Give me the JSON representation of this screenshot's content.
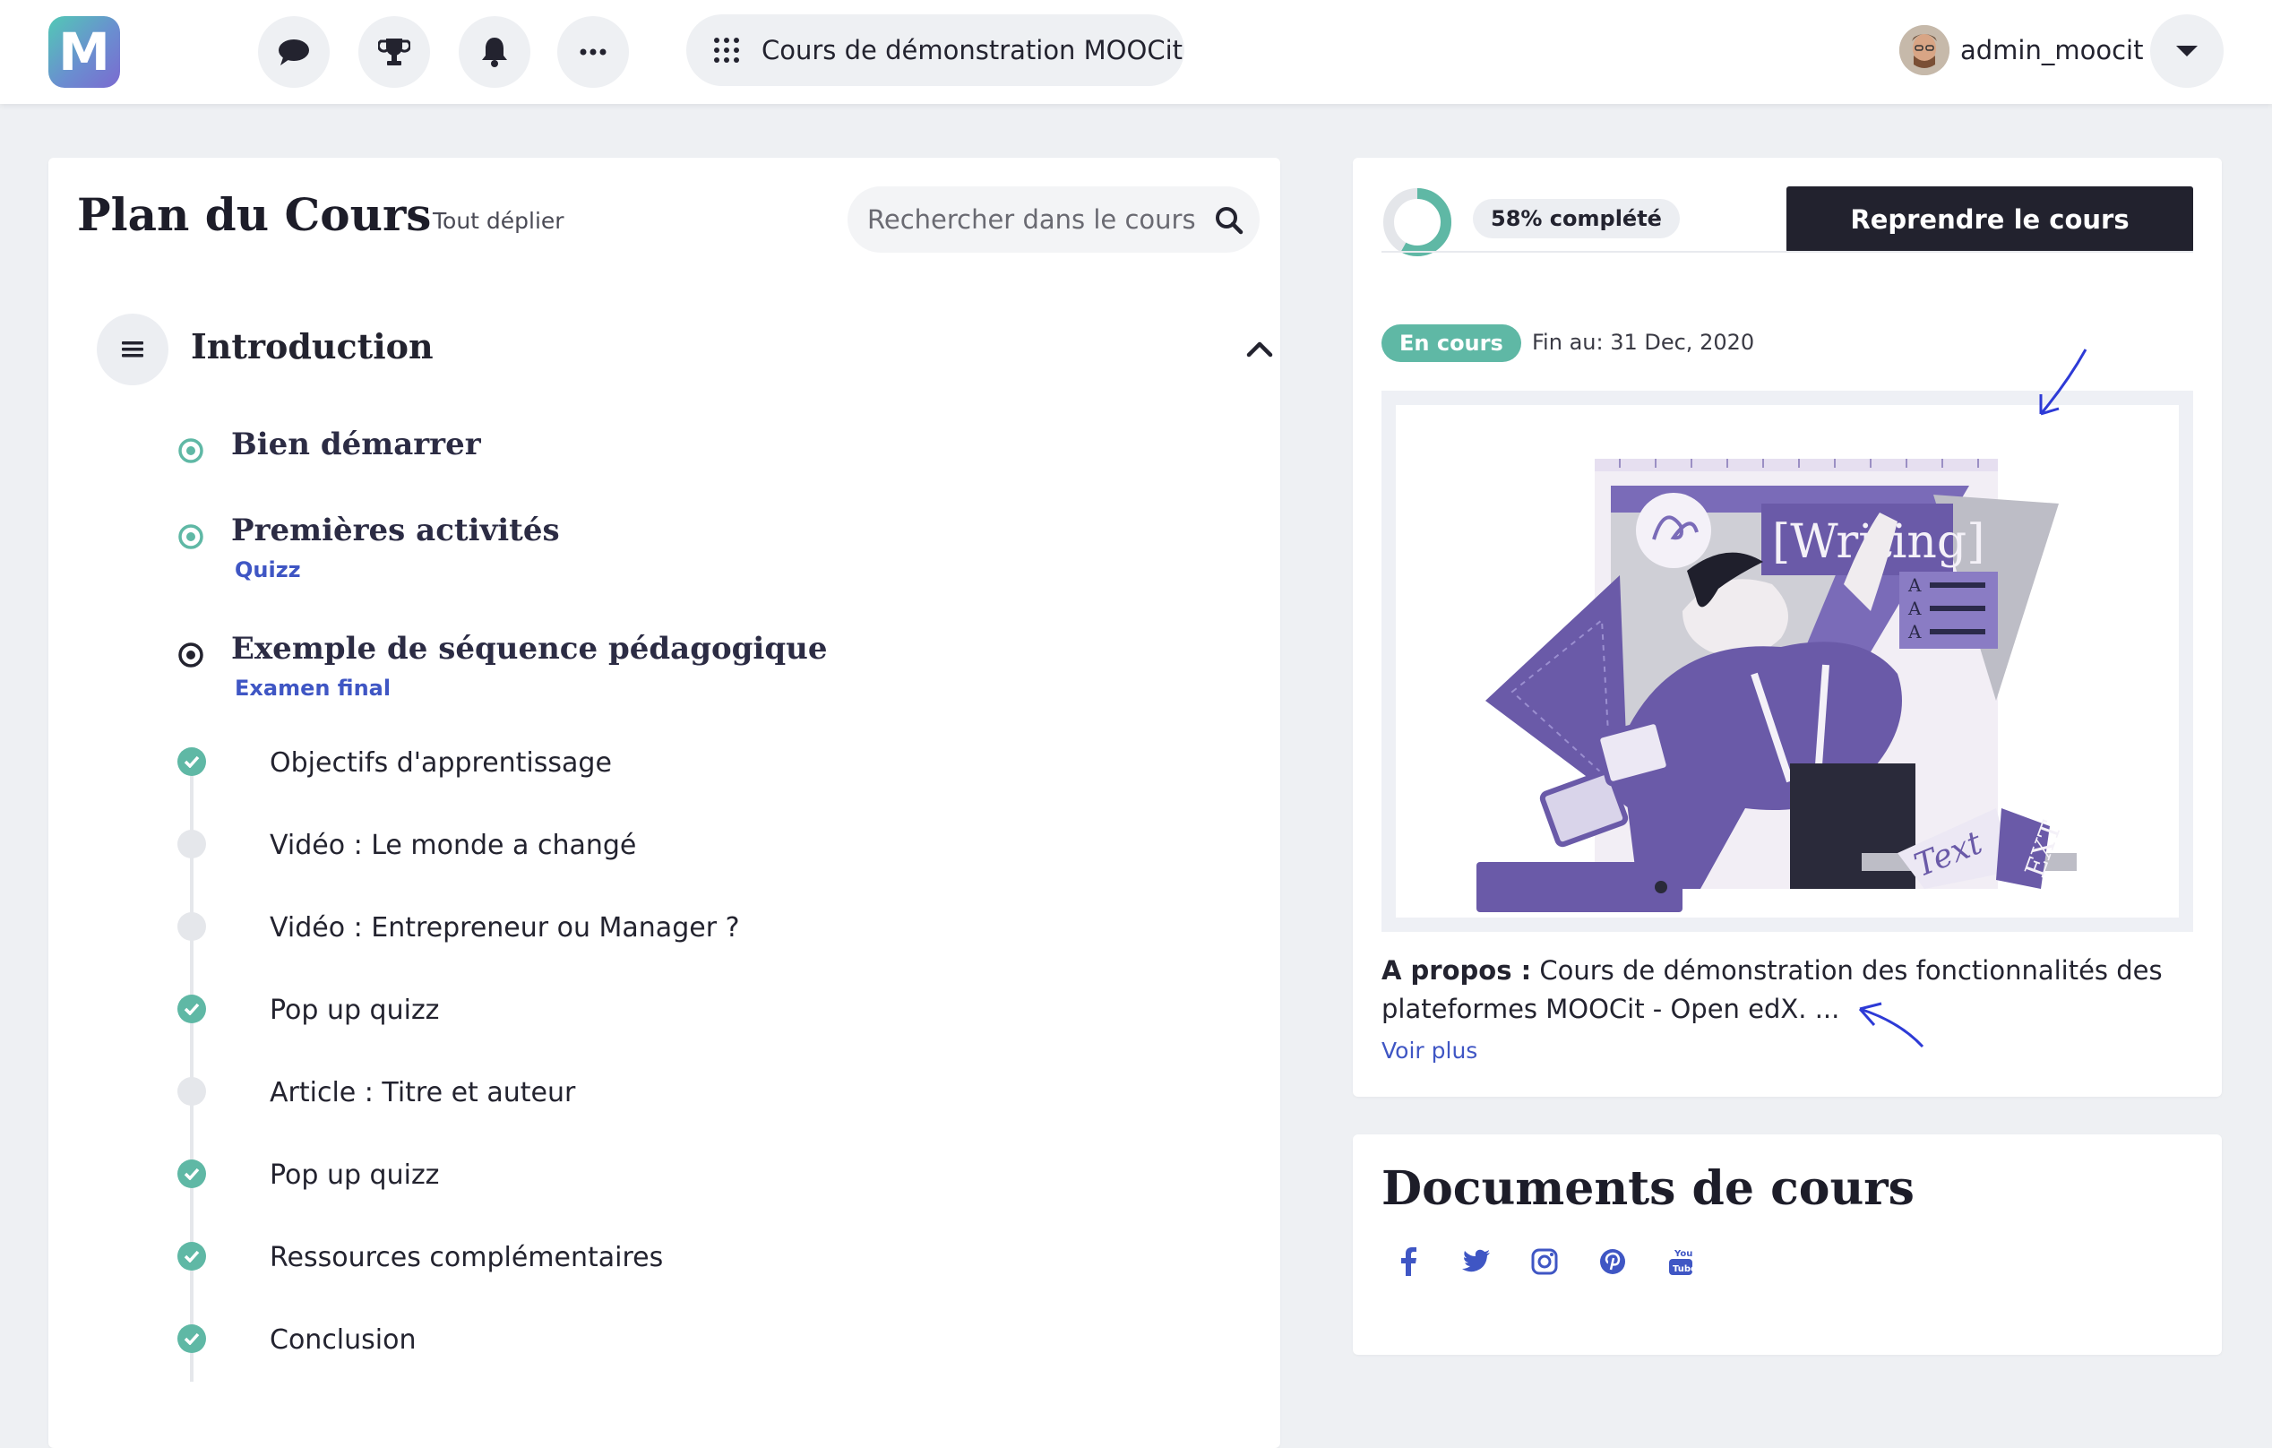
{
  "header": {
    "logo_letter": "M",
    "course_name": "Cours de démonstration MOOCit",
    "username": "admin_moocit",
    "icons": [
      "chat-icon",
      "trophy-icon",
      "bell-icon",
      "more-icon",
      "grid-icon",
      "chevron-down-icon"
    ]
  },
  "outline": {
    "title": "Plan du Cours",
    "expand_all": "Tout déplier",
    "search_placeholder": "Rechercher dans le cours",
    "section": {
      "title": "Introduction",
      "subsections": [
        {
          "title": "Bien démarrer",
          "tag": ""
        },
        {
          "title": "Premières activités",
          "tag": "Quizz"
        },
        {
          "title": "Exemple de séquence pédagogique",
          "tag": "Examen final"
        }
      ],
      "units": [
        {
          "label": "Objectifs d'apprentissage",
          "done": true
        },
        {
          "label": "Vidéo : Le monde a changé",
          "done": false
        },
        {
          "label": "Vidéo : Entrepreneur ou Manager ?",
          "done": false
        },
        {
          "label": "Pop up quizz",
          "done": true
        },
        {
          "label": "Article : Titre et auteur",
          "done": false
        },
        {
          "label": "Pop up quizz",
          "done": true
        },
        {
          "label": "Ressources complémentaires",
          "done": true
        },
        {
          "label": "Conclusion",
          "done": true
        }
      ]
    }
  },
  "course_info": {
    "progress_percent": 58,
    "progress_label": "58% complété",
    "resume_label": "Reprendre le cours",
    "status_label": "En cours",
    "end_date": "Fin au: 31 Dec, 2020",
    "about_label": "A propos :",
    "about_text": "Cours de démonstration des fonctionnalités des plateformes MOOCit - Open edX. ...",
    "see_more": "Voir plus",
    "banner_text_writing": "[Writing]",
    "banner_text_text": "Text",
    "banner_text_ext": "EXT"
  },
  "documents": {
    "title": "Documents de cours",
    "socials": [
      "facebook-icon",
      "twitter-icon",
      "instagram-icon",
      "pinterest-icon",
      "youtube-icon"
    ],
    "youtube_label": "You Tube"
  },
  "colors": {
    "accent_teal": "#5fb8a5",
    "link_blue": "#3f56c4",
    "dark_button": "#22222e",
    "illustration_purple": "#7a6bb8"
  }
}
